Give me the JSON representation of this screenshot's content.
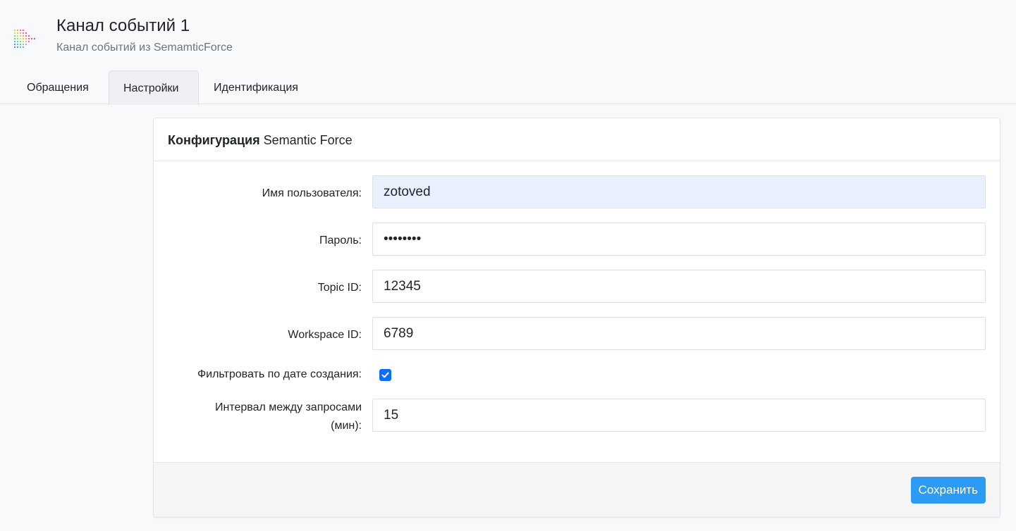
{
  "app": {
    "title": "Канал событий 1",
    "subtitle": "Канал событий из SemamticForce",
    "logo_icon": "dotted-arrow-logo"
  },
  "tabs": [
    {
      "label": "Обращения",
      "active": false
    },
    {
      "label": "Настройки",
      "active": true
    },
    {
      "label": "Идентификация",
      "active": false
    }
  ],
  "card": {
    "title_bold": "Конфигурация",
    "title_rest": " Semantic Force",
    "fields": {
      "username": {
        "label": "Имя пользователя:",
        "value": "zotoved"
      },
      "password": {
        "label": "Пароль:",
        "value": "12345678"
      },
      "topic_id": {
        "label": "Topic ID:",
        "value": "12345"
      },
      "workspace_id": {
        "label": "Workspace ID:",
        "value": "6789"
      },
      "filter_by_date": {
        "label": "Фильтровать по дате создания:",
        "checked": true
      },
      "interval": {
        "label_line1": "Интервал между запросами",
        "label_line2": "(мин):",
        "value": "15"
      }
    },
    "save_label": "Сохранить"
  },
  "colors": {
    "accent": "#2b9bf4",
    "checkbox": "#0d6efd",
    "autofill_bg": "#e8f0fe"
  }
}
